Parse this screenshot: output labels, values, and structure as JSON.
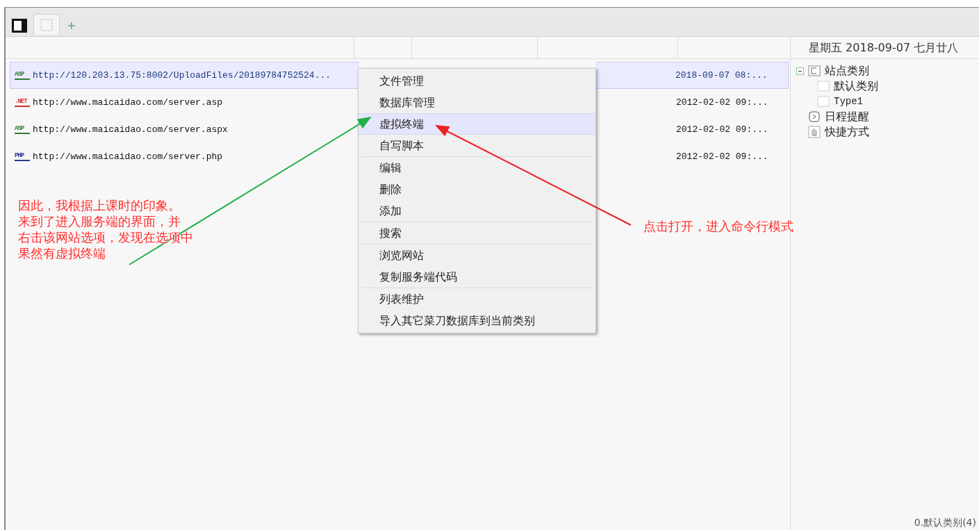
{
  "tabs": [
    {
      "kind": "panel",
      "selected": false
    },
    {
      "kind": "blank",
      "selected": true
    },
    {
      "kind": "add",
      "selected": false
    }
  ],
  "date_header": "星期五 2018-09-07 七月廿八",
  "rows": [
    {
      "badge": "ASP",
      "color": "#2e7d32",
      "url": "http://120.203.13.75:8002/UploadFiles/20189784752524...",
      "time": "2018-09-07 08:...",
      "selected": true
    },
    {
      "badge": ".NET",
      "color": "#d32f2f",
      "url": "http://www.maicaidao.com/server.asp",
      "time": "2012-02-02 09:...",
      "selected": false
    },
    {
      "badge": "ASP",
      "color": "#2e7d32",
      "url": "http://www.maicaidao.com/server.aspx",
      "time": "2012-02-02 09:...",
      "selected": false
    },
    {
      "badge": "PHP",
      "color": "#283593",
      "url": "http://www.maicaidao.com/server.php",
      "time": "2012-02-02 09:...",
      "selected": false
    }
  ],
  "context_menu": [
    [
      {
        "label": "文件管理",
        "selected": false
      },
      {
        "label": "数据库管理",
        "selected": false
      },
      {
        "label": "虚拟终端",
        "selected": true
      },
      {
        "label": "自写脚本",
        "selected": false
      }
    ],
    [
      {
        "label": "编辑",
        "selected": false
      },
      {
        "label": "删除",
        "selected": false
      },
      {
        "label": "添加",
        "selected": false
      }
    ],
    [
      {
        "label": "搜索",
        "selected": false
      }
    ],
    [
      {
        "label": "浏览网站",
        "selected": false
      },
      {
        "label": "复制服务端代码",
        "selected": false
      }
    ],
    [
      {
        "label": "列表维护",
        "selected": false
      },
      {
        "label": "导入其它菜刀数据库到当前类别",
        "selected": false
      }
    ]
  ],
  "tree": [
    {
      "kind": "category",
      "label": "站点类别",
      "expanded": true,
      "children": [
        {
          "kind": "item",
          "label": "默认类别"
        },
        {
          "kind": "item",
          "label": "Type1"
        }
      ]
    },
    {
      "kind": "schedule",
      "label": "日程提醒"
    },
    {
      "kind": "shortcut",
      "label": "快捷方式"
    }
  ],
  "status_bar": "0.默认类别(4)",
  "annotations": [
    {
      "color": "#ff2a2a",
      "lines": [
        "因此，我根据上课时的印象。",
        "来到了进入服务端的界面，并",
        "右击该网站选项，发现在选项中",
        "果然有虚拟终端"
      ]
    },
    {
      "color": "#ff2a2a",
      "lines": [
        "点击打开，进入命令行模式"
      ]
    }
  ],
  "arrows": [
    {
      "color": "#22b04b"
    },
    {
      "color": "#ee2222"
    }
  ]
}
